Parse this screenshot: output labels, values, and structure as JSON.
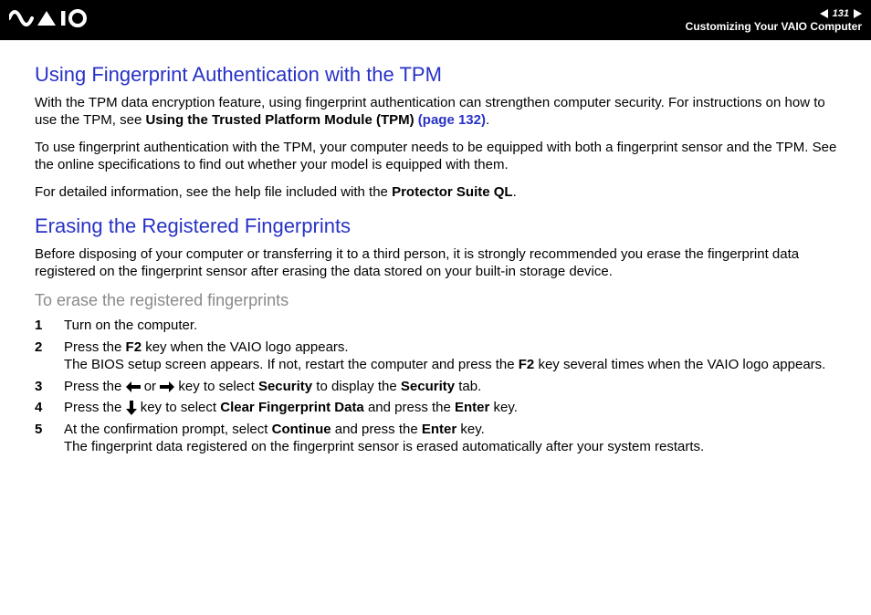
{
  "header": {
    "page_number": "131",
    "section": "Customizing Your VAIO Computer"
  },
  "body": {
    "h1_tpm": "Using Fingerprint Authentication with the TPM",
    "p_tpm_1a": "With the TPM data encryption feature, using fingerprint authentication can strengthen computer security. For instructions on how to use the TPM, see ",
    "p_tpm_1b": "Using the Trusted Platform Module (TPM)",
    "p_tpm_1c": "(page 132)",
    "p_tpm_2": "To use fingerprint authentication with the TPM, your computer needs to be equipped with both a fingerprint sensor and the TPM. See the online specifications to find out whether your model is equipped with them.",
    "p_tpm_3a": "For detailed information, see the help file included with the ",
    "p_tpm_3b": "Protector Suite QL",
    "h1_erase": "Erasing the Registered Fingerprints",
    "p_erase_1": "Before disposing of your computer or transferring it to a third person, it is strongly recommended you erase the fingerprint data registered on the fingerprint sensor after erasing the data stored on your built-in storage device.",
    "h2_erase_proc": "To erase the registered fingerprints",
    "steps": {
      "n1": "1",
      "s1": "Turn on the computer.",
      "n2": "2",
      "s2a": "Press the ",
      "s2b": "F2",
      "s2c": " key when the VAIO logo appears.",
      "s2d": "The BIOS setup screen appears. If not, restart the computer and press the ",
      "s2e": "F2",
      "s2f": " key several times when the VAIO logo appears.",
      "n3": "3",
      "s3a": "Press the ",
      "s3b": " or ",
      "s3c": " key to select ",
      "s3d": "Security",
      "s3e": " to display the ",
      "s3f": "Security",
      "s3g": " tab.",
      "n4": "4",
      "s4a": "Press the ",
      "s4b": " key to select ",
      "s4c": "Clear Fingerprint Data",
      "s4d": " and press the ",
      "s4e": "Enter",
      "s4f": " key.",
      "n5": "5",
      "s5a": "At the confirmation prompt, select ",
      "s5b": "Continue",
      "s5c": " and press the ",
      "s5d": "Enter",
      "s5e": " key.",
      "s5f": "The fingerprint data registered on the fingerprint sensor is erased automatically after your system restarts."
    }
  }
}
